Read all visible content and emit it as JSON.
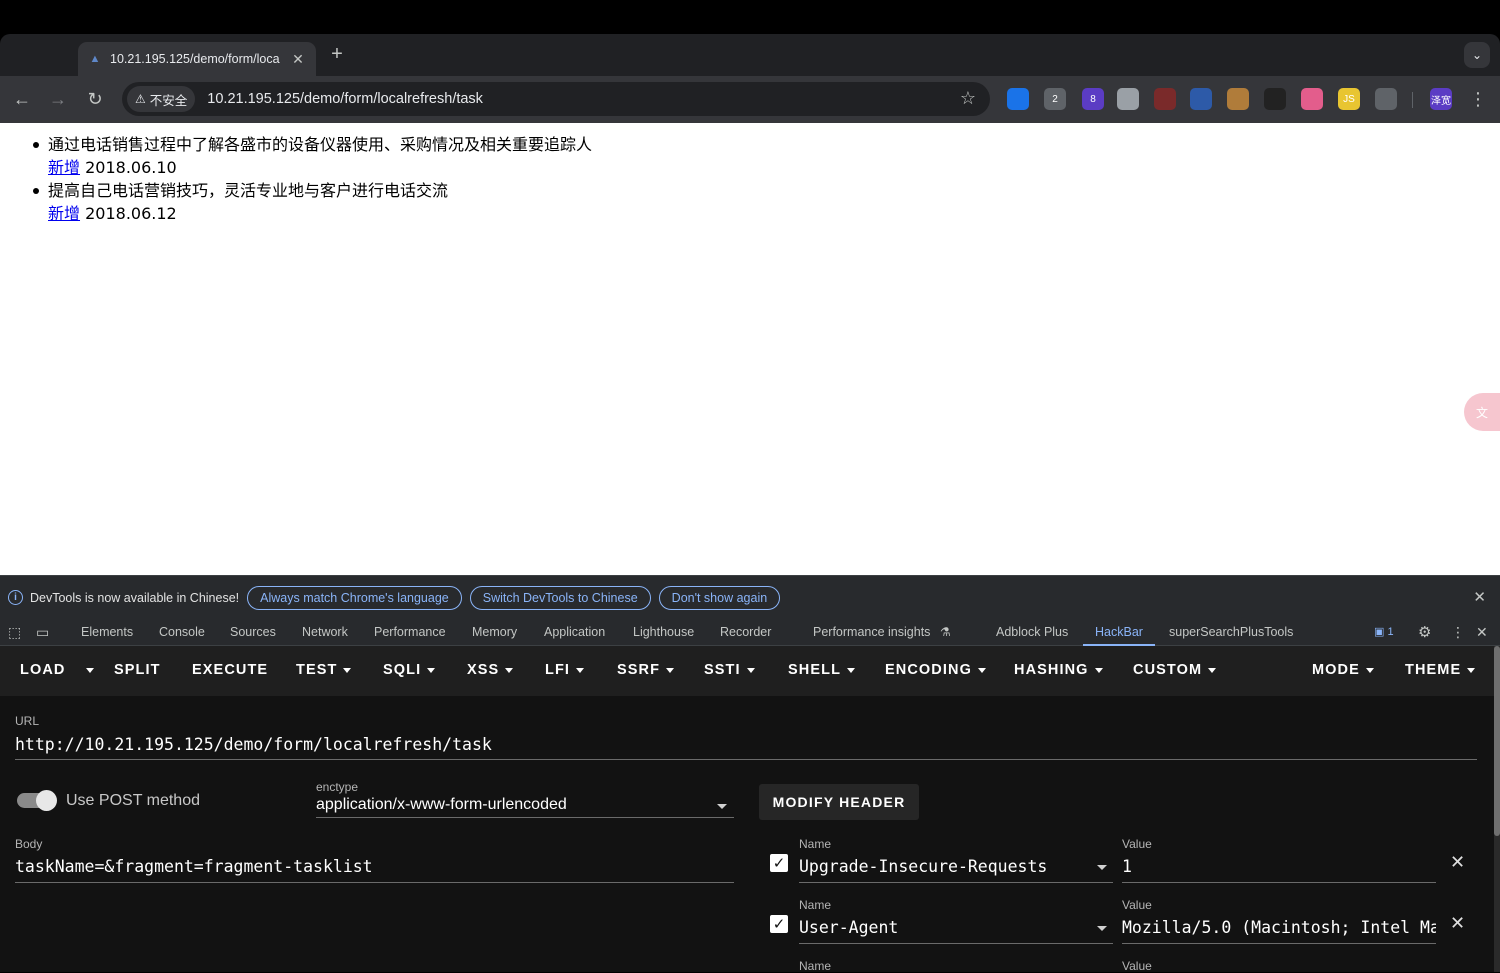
{
  "tab": {
    "title": "10.21.195.125/demo/form/loca",
    "close": "✕"
  },
  "newtab": "+",
  "omnibox": {
    "security": "不安全",
    "url": "10.21.195.125/demo/form/localrefresh/task"
  },
  "extensions": [
    {
      "name": "ext-circle",
      "label": "",
      "color": "#1a73e8"
    },
    {
      "name": "ext-badge-2",
      "label": "2",
      "color": "#5f6368"
    },
    {
      "name": "ext-badge-8",
      "label": "8",
      "color": "#5b3cc4"
    },
    {
      "name": "ext-cloud",
      "label": "",
      "color": "#9aa0a6"
    },
    {
      "name": "ext-red",
      "label": "",
      "color": "#7a2a2a"
    },
    {
      "name": "ext-blue-figure",
      "label": "",
      "color": "#2d5aa8"
    },
    {
      "name": "ext-cookie",
      "label": "",
      "color": "#b07c3a"
    },
    {
      "name": "ext-hat",
      "label": "",
      "color": "#222"
    },
    {
      "name": "ext-translate",
      "label": "",
      "color": "#e35d8c"
    },
    {
      "name": "ext-js",
      "label": "JS",
      "color": "#e8c531"
    },
    {
      "name": "ext-puzzle",
      "label": "",
      "color": "#5f6368"
    },
    {
      "name": "ext-profile",
      "label": "泽宽",
      "color": "#5b3cc4"
    }
  ],
  "page": {
    "items": [
      {
        "text": "通过电话销售过程中了解各盛市的设备仪器使用、采购情况及相关重要追踪人",
        "link": "新增",
        "date": "2018.06.10"
      },
      {
        "text": "提高自己电话营销技巧，灵活专业地与客户进行电话交流",
        "link": "新增",
        "date": "2018.06.12"
      }
    ]
  },
  "infobar": {
    "message": "DevTools is now available in Chinese!",
    "buttons": [
      "Always match Chrome's language",
      "Switch DevTools to Chinese",
      "Don't show again"
    ]
  },
  "devtools_tabs": [
    "Elements",
    "Console",
    "Sources",
    "Network",
    "Performance",
    "Memory",
    "Application",
    "Lighthouse",
    "Recorder",
    "Performance insights",
    "Adblock Plus",
    "HackBar",
    "superSearchPlusTools"
  ],
  "devtools_issue_count": "1",
  "hackbar": {
    "menu": [
      "LOAD",
      "SPLIT",
      "EXECUTE",
      "TEST",
      "SQLI",
      "XSS",
      "LFI",
      "SSRF",
      "SSTI",
      "SHELL",
      "ENCODING",
      "HASHING",
      "CUSTOM",
      "MODE",
      "THEME"
    ],
    "url_label": "URL",
    "url_value": "http://10.21.195.125/demo/form/localrefresh/task",
    "post_label": "Use POST method",
    "enctype_label": "enctype",
    "enctype_value": "application/x-www-form-urlencoded",
    "modify_header": "MODIFY HEADER",
    "body_label": "Body",
    "body_value": "taskName=&fragment=fragment-tasklist",
    "headers": [
      {
        "name_label": "Name",
        "name": "Upgrade-Insecure-Requests",
        "value_label": "Value",
        "value": "1"
      },
      {
        "name_label": "Name",
        "name": "User-Agent",
        "value_label": "Value",
        "value": "Mozilla/5.0 (Macintosh; Intel Ma"
      },
      {
        "name_label": "Name",
        "name": "",
        "value_label": "Value",
        "value": ""
      }
    ]
  }
}
